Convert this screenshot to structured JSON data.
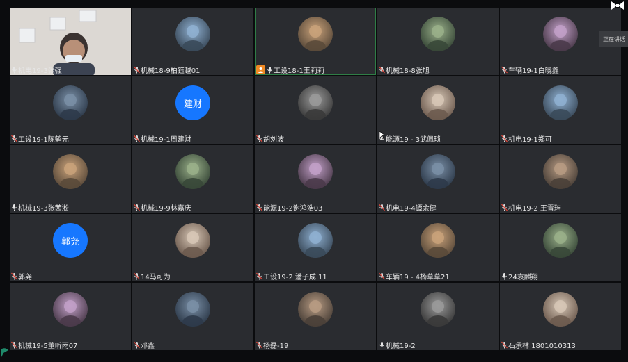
{
  "speaking_tooltip": "正在讲话",
  "host_badge_icon": "user-icon",
  "accent_color": "#1677ff",
  "participants": [
    {
      "name": "机电19-3张强",
      "avatar": "camera-feed",
      "mic": "on"
    },
    {
      "name": "机械18-9柏鈺越01",
      "avatar": "photo",
      "mic": "muted"
    },
    {
      "name": "工设18-1王莉莉",
      "avatar": "photo",
      "mic": "on",
      "host": true,
      "active": true
    },
    {
      "name": "机械18-8张旭",
      "avatar": "photo",
      "mic": "muted"
    },
    {
      "name": "车辆19-1白晓鑫",
      "avatar": "photo",
      "mic": "muted"
    },
    {
      "name": "工设19-1陈鹤元",
      "avatar": "photo",
      "mic": "muted"
    },
    {
      "name": "机械19-1周建财",
      "avatar": "text",
      "avatar_text": "建财",
      "mic": "muted"
    },
    {
      "name": "胡刘波",
      "avatar": "photo",
      "mic": "muted"
    },
    {
      "name": "能源19 - 3武佩琐",
      "avatar": "photo",
      "mic": "on"
    },
    {
      "name": "机电19-1郑可",
      "avatar": "photo",
      "mic": "muted"
    },
    {
      "name": "机械19-3张茜淞",
      "avatar": "photo",
      "mic": "on"
    },
    {
      "name": "机械19-9林嘉庆",
      "avatar": "photo",
      "mic": "muted"
    },
    {
      "name": "能源19-2谢鸿浩03",
      "avatar": "photo",
      "mic": "muted"
    },
    {
      "name": "机电19-4谭余健",
      "avatar": "photo",
      "mic": "muted"
    },
    {
      "name": "机电19-2 王雪玙",
      "avatar": "photo",
      "mic": "muted"
    },
    {
      "name": "郭尧",
      "avatar": "text",
      "avatar_text": "郭尧",
      "mic": "muted"
    },
    {
      "name": "14马可为",
      "avatar": "photo",
      "mic": "muted"
    },
    {
      "name": "工设19-2 潘子成 11",
      "avatar": "photo",
      "mic": "muted"
    },
    {
      "name": "车辆19 - 4杨草草21",
      "avatar": "photo",
      "mic": "muted"
    },
    {
      "name": "24袁麒翔",
      "avatar": "photo",
      "mic": "on"
    },
    {
      "name": "机械19-5董昕雨07",
      "avatar": "photo",
      "mic": "muted"
    },
    {
      "name": "邓鑫",
      "avatar": "photo",
      "mic": "muted"
    },
    {
      "name": "杨磊-19",
      "avatar": "photo",
      "mic": "muted"
    },
    {
      "name": "机械19-2",
      "avatar": "photo",
      "mic": "on"
    },
    {
      "name": "石承林 1801010313",
      "avatar": "photo",
      "mic": "muted"
    }
  ]
}
